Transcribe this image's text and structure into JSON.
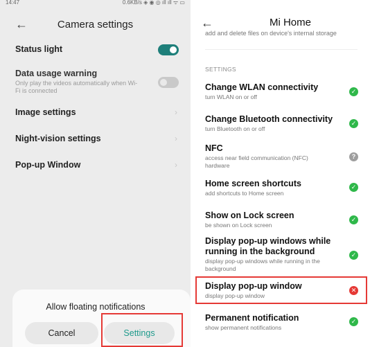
{
  "colors": {
    "accent_teal": "#1e7f7a",
    "settings_button_text": "#1e9a8c",
    "highlight_red": "#e53935",
    "status_ok": "#2fb84a",
    "status_unknown": "#9e9e9e",
    "status_denied": "#e53935"
  },
  "left": {
    "statusbar": {
      "time": "14:47",
      "indicators": "0.6KB/s ◈ ◉ ◎ ıll ıll ᯤ ▭"
    },
    "header": {
      "title": "Camera settings",
      "back_icon": "back-arrow-icon"
    },
    "settings": [
      {
        "label": "Status light",
        "toggle": "on"
      },
      {
        "label": "Data usage warning",
        "sublabel": "Only play the videos automatically when Wi-Fi is connected",
        "toggle": "off"
      },
      {
        "label": "Image settings",
        "chevron": "›"
      },
      {
        "label": "Night-vision settings",
        "chevron": "›"
      },
      {
        "label": "Pop-up Window",
        "chevron": "›"
      }
    ],
    "dialog": {
      "message": "Allow floating notifications",
      "cancel_label": "Cancel",
      "settings_label": "Settings"
    }
  },
  "right": {
    "header": {
      "title": "Mi Home",
      "back_icon": "back-arrow-icon"
    },
    "cut_off_text": "add and delete files on device's internal storage",
    "section_label": "SETTINGS",
    "permissions": [
      {
        "title": "Change WLAN connectivity",
        "sub": "turn WLAN on or off",
        "status": "allowed",
        "glyph": "✓"
      },
      {
        "title": "Change Bluetooth connectivity",
        "sub": "turn Bluetooth on or off",
        "status": "allowed",
        "glyph": "✓"
      },
      {
        "title": "NFC",
        "sub": "access near field communication (NFC) hardware",
        "status": "ask",
        "glyph": "?"
      },
      {
        "title": "Home screen shortcuts",
        "sub": "add shortcuts to Home screen",
        "status": "allowed",
        "glyph": "✓"
      },
      {
        "title": "Show on Lock screen",
        "sub": "be shown on Lock screen",
        "status": "allowed",
        "glyph": "✓"
      },
      {
        "title": "Display pop-up windows while running in the background",
        "sub": "display pop-up windows while running in the background",
        "status": "allowed",
        "glyph": "✓"
      },
      {
        "title": "Display pop-up window",
        "sub": "display pop-up window",
        "status": "denied",
        "glyph": "✕"
      },
      {
        "title": "Permanent notification",
        "sub": "show permanent notifications",
        "status": "allowed",
        "glyph": "✓"
      }
    ]
  }
}
